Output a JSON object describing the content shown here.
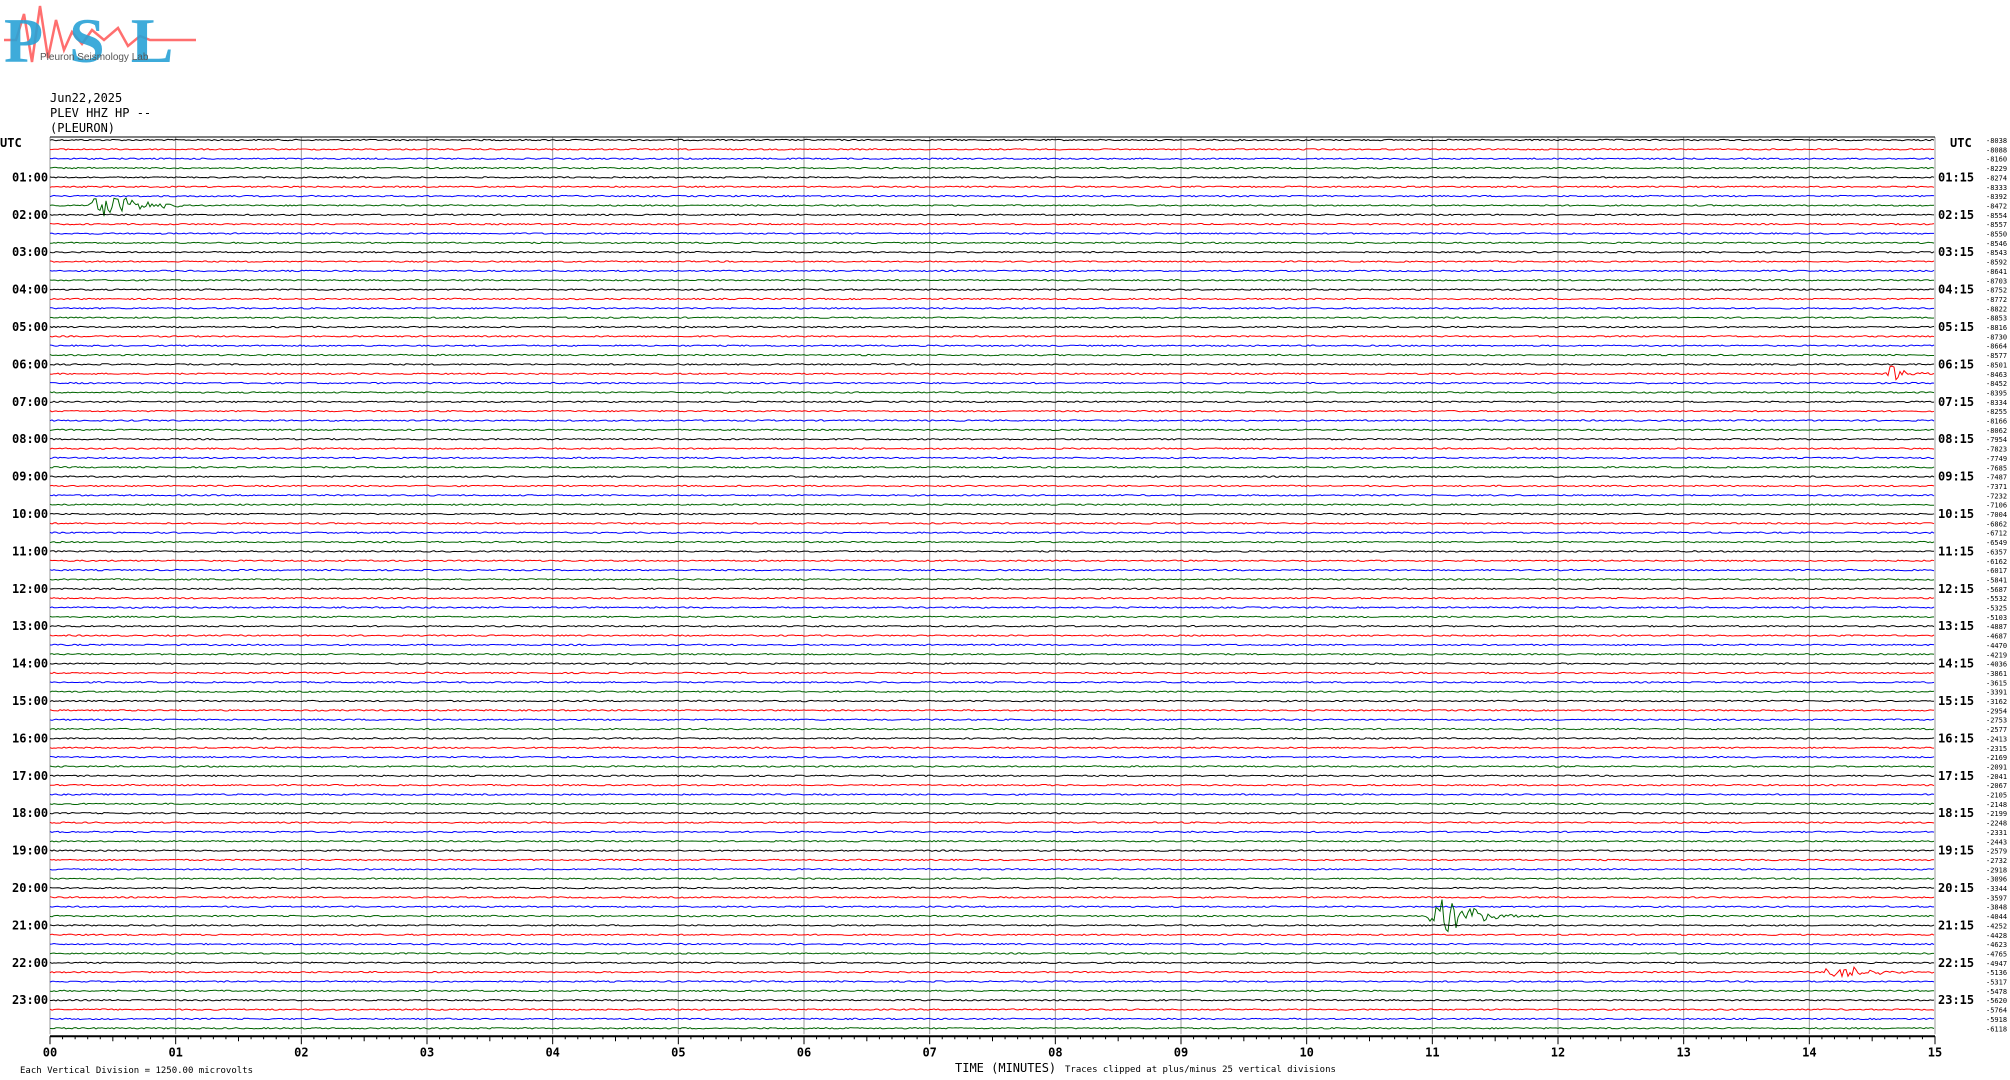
{
  "header": {
    "logo_text": "PSL",
    "logo_subtitle": "Pleuron Seismology Lab",
    "date": "Jun22,2025",
    "channel": "PLEV HHZ HP --",
    "station": "(PLEURON)",
    "utc_left": "UTC",
    "utc_right": "UTC"
  },
  "footer": {
    "scale_note": "Each Vertical Division = 1250.00 microvolts",
    "xlabel": "TIME (MINUTES)",
    "clip_note": "Traces clipped at plus/minus 25 vertical divisions"
  },
  "colors": {
    "black": "#000000",
    "red": "#ff0000",
    "blue": "#0000ff",
    "green": "#006400",
    "grid": "#9a9a9a"
  },
  "chart_data": {
    "type": "line",
    "description_of_rows": "96 helicorder traces, 15 minutes each, colours cycle black, red, blue, green",
    "x_ticks": [
      "00",
      "01",
      "02",
      "03",
      "04",
      "05",
      "06",
      "07",
      "08",
      "09",
      "10",
      "11",
      "12",
      "13",
      "14",
      "15"
    ],
    "xlim": [
      0,
      15
    ],
    "left_hour_labels": [
      "01:00",
      "02:00",
      "03:00",
      "04:00",
      "05:00",
      "06:00",
      "07:00",
      "08:00",
      "09:00",
      "10:00",
      "11:00",
      "12:00",
      "13:00",
      "14:00",
      "15:00",
      "16:00",
      "17:00",
      "18:00",
      "19:00",
      "20:00",
      "21:00",
      "22:00",
      "23:00"
    ],
    "right_hour_labels": [
      "01:15",
      "02:15",
      "03:15",
      "04:15",
      "05:15",
      "06:15",
      "07:15",
      "08:15",
      "09:15",
      "10:15",
      "11:15",
      "12:15",
      "13:15",
      "14:15",
      "15:15",
      "16:15",
      "17:15",
      "18:15",
      "19:15",
      "20:15",
      "21:15",
      "22:15",
      "23:15"
    ],
    "right_offsets": [
      "-8038",
      "-8088",
      "-8160",
      "-8229",
      "-8274",
      "-8333",
      "-8392",
      "-8472",
      "-8554",
      "-8557",
      "-8550",
      "-8546",
      "-8543",
      "-8592",
      "-8641",
      "-8703",
      "-8752",
      "-8772",
      "-8822",
      "-8853",
      "-8816",
      "-8730",
      "-8664",
      "-8577",
      "-8501",
      "-8463",
      "-8452",
      "-8395",
      "-8334",
      "-8255",
      "-8166",
      "-8062",
      "-7954",
      "-7823",
      "-7749",
      "-7685",
      "-7487",
      "-7371",
      "-7232",
      "-7106",
      "-7004",
      "-6862",
      "-6712",
      "-6549",
      "-6357",
      "-6162",
      "-6017",
      "-5841",
      "-5687",
      "-5532",
      "-5325",
      "-5103",
      "-4887",
      "-4687",
      "-4470",
      "-4219",
      "-4036",
      "-3861",
      "-3615",
      "-3391",
      "-3162",
      "-2954",
      "-2753",
      "-2577",
      "-2413",
      "-2315",
      "-2169",
      "-2091",
      "-2041",
      "-2067",
      "-2105",
      "-2148",
      "-2199",
      "-2248",
      "-2331",
      "-2443",
      "-2579",
      "-2732",
      "-2918",
      "-3096",
      "-3344",
      "-3597",
      "-3848",
      "-4044",
      "-4252",
      "-4428",
      "-4623",
      "-4765",
      "-4947",
      "-5136",
      "-5317",
      "-5478",
      "-5620",
      "-5764",
      "-5918",
      "-6118"
    ],
    "events": [
      {
        "row": 7,
        "start_min": 0.3,
        "end_min": 1.25,
        "amplitude": 1.8
      },
      {
        "row": 25,
        "start_min": 14.6,
        "end_min": 15.0,
        "amplitude": 1.2
      },
      {
        "row": 83,
        "start_min": 10.95,
        "end_min": 11.9,
        "amplitude": 2.3
      },
      {
        "row": 89,
        "start_min": 14.1,
        "end_min": 15.0,
        "amplitude": 1.0
      }
    ]
  }
}
